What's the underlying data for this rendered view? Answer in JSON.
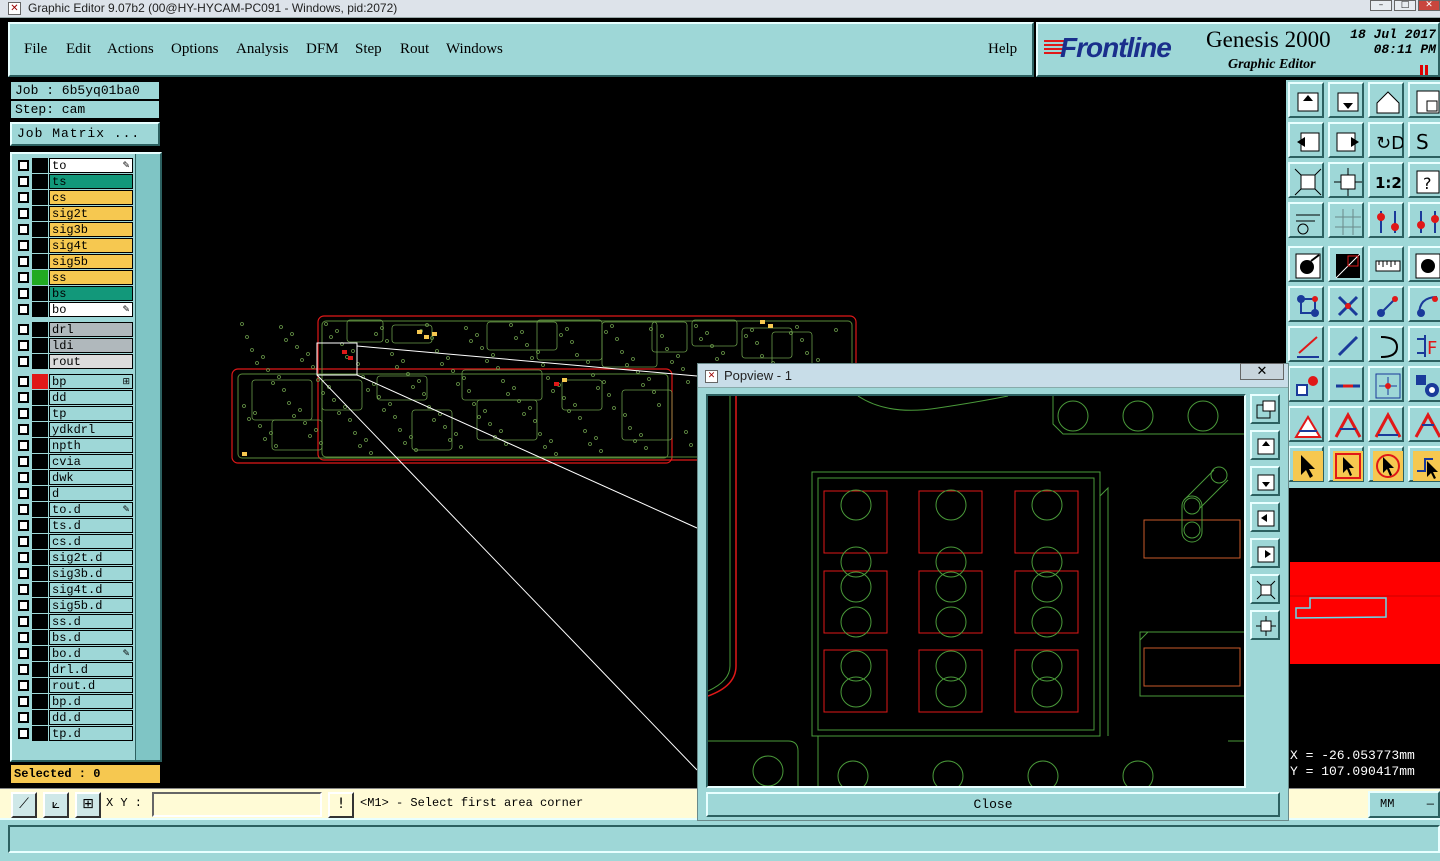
{
  "window": {
    "title": "Graphic Editor 9.07b2 (00@HY-HYCAM-PC091 - Windows, pid:2072)"
  },
  "menu": {
    "items": [
      "File",
      "Edit",
      "Actions",
      "Options",
      "Analysis",
      "DFM",
      "Step",
      "Rout",
      "Windows"
    ],
    "help": "Help"
  },
  "brand": {
    "logo": "Frontline",
    "product": "Genesis 2000",
    "subtitle": "Graphic Editor",
    "date": "18 Jul 2017",
    "time": "08:11 PM"
  },
  "job": {
    "job_label": "Job : 6b5yq01ba0",
    "step_label": "Step: cam",
    "matrix_button": "Job Matrix ..."
  },
  "layers": [
    {
      "name": "to",
      "color": "#ffffff",
      "swatch": "#000000",
      "mark": "✎"
    },
    {
      "name": "ts",
      "color": "#12987a",
      "swatch": "#000000",
      "mark": ""
    },
    {
      "name": "cs",
      "color": "#f6c850",
      "swatch": "#000000",
      "mark": ""
    },
    {
      "name": "sig2t",
      "color": "#f6c850",
      "swatch": "#000000",
      "mark": ""
    },
    {
      "name": "sig3b",
      "color": "#f6c850",
      "swatch": "#000000",
      "mark": ""
    },
    {
      "name": "sig4t",
      "color": "#f6c850",
      "swatch": "#000000",
      "mark": ""
    },
    {
      "name": "sig5b",
      "color": "#f6c850",
      "swatch": "#000000",
      "mark": ""
    },
    {
      "name": "ss",
      "color": "#f6c850",
      "swatch": "#22aa22",
      "mark": ""
    },
    {
      "name": "bs",
      "color": "#12987a",
      "swatch": "#000000",
      "mark": ""
    },
    {
      "name": "bo",
      "color": "#ffffff",
      "swatch": "#000000",
      "mark": "✎"
    },
    {
      "name": "drl",
      "color": "#b0b8bc",
      "swatch": "#000000",
      "mark": ""
    },
    {
      "name": "ldi",
      "color": "#b0b8bc",
      "swatch": "#000000",
      "mark": ""
    },
    {
      "name": "rout",
      "color": "#dcdcdc",
      "swatch": "#000000",
      "mark": ""
    },
    {
      "name": "bp",
      "color": "#9ed7d7",
      "swatch": "#e01818",
      "mark": "⊞"
    },
    {
      "name": "dd",
      "color": "#9ed7d7",
      "swatch": "#000000",
      "mark": ""
    },
    {
      "name": "tp",
      "color": "#9ed7d7",
      "swatch": "#000000",
      "mark": ""
    },
    {
      "name": "ydkdrl",
      "color": "#9ed7d7",
      "swatch": "#000000",
      "mark": ""
    },
    {
      "name": "npth",
      "color": "#9ed7d7",
      "swatch": "#000000",
      "mark": ""
    },
    {
      "name": "cvia",
      "color": "#9ed7d7",
      "swatch": "#000000",
      "mark": ""
    },
    {
      "name": "dwk",
      "color": "#9ed7d7",
      "swatch": "#000000",
      "mark": ""
    },
    {
      "name": "d",
      "color": "#9ed7d7",
      "swatch": "#000000",
      "mark": ""
    },
    {
      "name": "to.d",
      "color": "#9ed7d7",
      "swatch": "#000000",
      "mark": "✎"
    },
    {
      "name": "ts.d",
      "color": "#9ed7d7",
      "swatch": "#000000",
      "mark": ""
    },
    {
      "name": "cs.d",
      "color": "#9ed7d7",
      "swatch": "#000000",
      "mark": ""
    },
    {
      "name": "sig2t.d",
      "color": "#9ed7d7",
      "swatch": "#000000",
      "mark": ""
    },
    {
      "name": "sig3b.d",
      "color": "#9ed7d7",
      "swatch": "#000000",
      "mark": ""
    },
    {
      "name": "sig4t.d",
      "color": "#9ed7d7",
      "swatch": "#000000",
      "mark": ""
    },
    {
      "name": "sig5b.d",
      "color": "#9ed7d7",
      "swatch": "#000000",
      "mark": ""
    },
    {
      "name": "ss.d",
      "color": "#9ed7d7",
      "swatch": "#000000",
      "mark": ""
    },
    {
      "name": "bs.d",
      "color": "#9ed7d7",
      "swatch": "#000000",
      "mark": ""
    },
    {
      "name": "bo.d",
      "color": "#9ed7d7",
      "swatch": "#000000",
      "mark": "✎"
    },
    {
      "name": "drl.d",
      "color": "#9ed7d7",
      "swatch": "#000000",
      "mark": ""
    },
    {
      "name": "rout.d",
      "color": "#9ed7d7",
      "swatch": "#000000",
      "mark": ""
    },
    {
      "name": "bp.d",
      "color": "#9ed7d7",
      "swatch": "#000000",
      "mark": ""
    },
    {
      "name": "dd.d",
      "color": "#9ed7d7",
      "swatch": "#000000",
      "mark": ""
    },
    {
      "name": "tp.d",
      "color": "#9ed7d7",
      "swatch": "#000000",
      "mark": ""
    }
  ],
  "selected": {
    "label": "Selected : 0"
  },
  "bottom": {
    "xy_label": "X Y :",
    "xy_value": "",
    "message": "<M1> - Select first area corner",
    "units": "MM",
    "info_mark": "!"
  },
  "coords": {
    "x": "X = -26.053773mm",
    "y": "Y = 107.090417mm"
  },
  "popup": {
    "title": "Popview - 1",
    "close_label": "Close",
    "close_x": "✕"
  },
  "icons": {
    "tools": [
      "home-icon",
      "bottom-icon",
      "house-icon",
      "zoom-window-icon",
      "zoom-left-icon",
      "zoom-right-icon",
      "flip-icon",
      "snap-icon",
      "fit-all-icon",
      "fit-center-icon",
      "scale-1-2-icon",
      "help-icon",
      "pan-icon",
      "grid-icon",
      "net-red-icon",
      "net-dual-icon",
      "add-pad-icon",
      "rect-area-icon",
      "ruler-icon",
      "dot-icon",
      "node-icon",
      "cross-icon",
      "line-dot-icon",
      "arc-dot-icon",
      "line-icon",
      "diag-line-icon",
      "arc-icon",
      "align-icon",
      "circle-square-icon",
      "h-line-icon",
      "snap-center-icon",
      "group-icon",
      "triangle-icon",
      "triangle-a-icon",
      "triangle-b-icon",
      "triangle-c-icon",
      "pointer-icon",
      "pointer-box-icon",
      "pointer-circle-icon",
      "pointer-net-icon"
    ]
  }
}
